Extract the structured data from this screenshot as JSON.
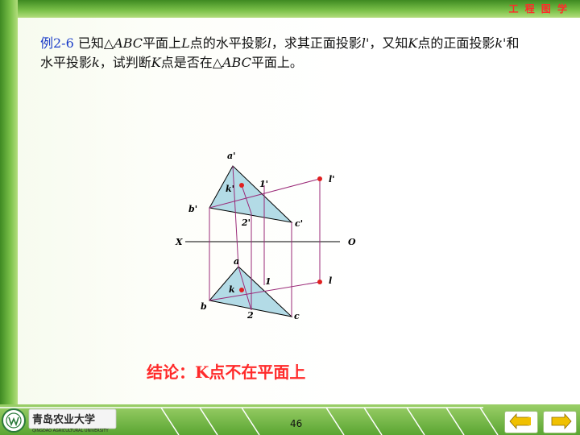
{
  "header": {
    "brand_tag": "工 程 图 学"
  },
  "problem": {
    "label": "例2-6",
    "segments": [
      {
        "t": "  已知△",
        "i": false
      },
      {
        "t": "ABC",
        "i": true
      },
      {
        "t": "平面上",
        "i": false
      },
      {
        "t": "L",
        "i": true
      },
      {
        "t": "点的水平投影",
        "i": false
      },
      {
        "t": "l",
        "i": true
      },
      {
        "t": "，求其正面投影",
        "i": false
      },
      {
        "t": "l'",
        "i": true
      },
      {
        "t": "，又知",
        "i": false
      },
      {
        "t": "K",
        "i": true
      },
      {
        "t": "点的正面投影",
        "i": false
      },
      {
        "t": "k'",
        "i": true
      },
      {
        "t": "和水平投影",
        "i": false
      },
      {
        "t": "k",
        "i": true
      },
      {
        "t": "，试判断",
        "i": false
      },
      {
        "t": "K",
        "i": true
      },
      {
        "t": "点是否在△",
        "i": false
      },
      {
        "t": "ABC",
        "i": true
      },
      {
        "t": "平面上。",
        "i": false
      }
    ]
  },
  "diagram": {
    "labels": {
      "a_prime": "a'",
      "b_prime": "b'",
      "c_prime": "c'",
      "k_prime": "k'",
      "one_prime": "1'",
      "two_prime": "2'",
      "l_prime": "l'",
      "x_axis": "X",
      "o_axis": "O",
      "a": "a",
      "b": "b",
      "c": "c",
      "k": "k",
      "one": "1",
      "two": "2",
      "l": "l"
    },
    "colors": {
      "triangle_fill": "#b3dbe6",
      "outline": "#000000",
      "construction": "#9a2a78",
      "point": "#e02020"
    }
  },
  "conclusion": "结论：K点不在平面上",
  "footer": {
    "logo_text": "青岛农业大学",
    "logo_subtext": "QINGDAO AGRICULTURAL UNIVERSITY",
    "page_number": "46",
    "colors": {
      "arrow": "#f0c000"
    }
  }
}
